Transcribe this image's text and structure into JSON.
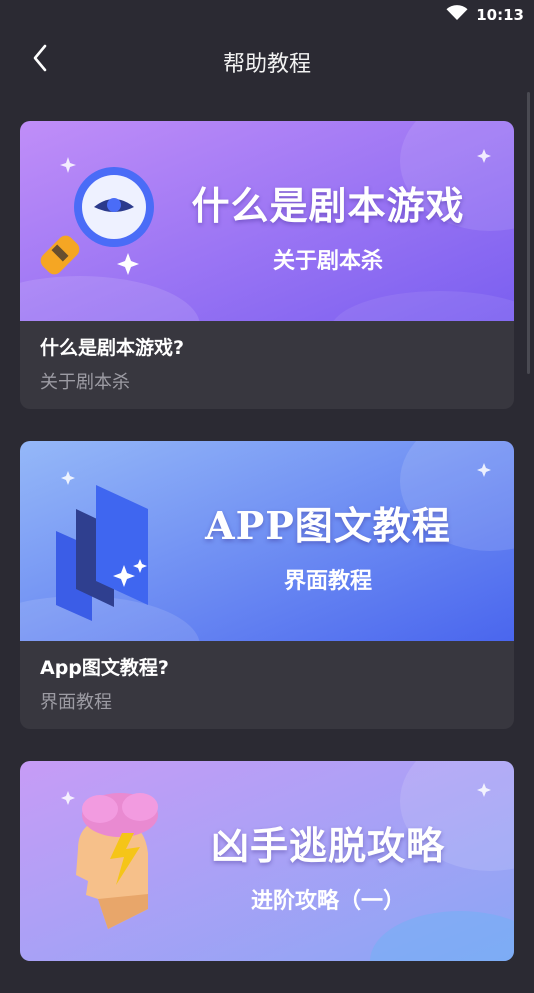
{
  "status": {
    "time": "10:13",
    "wifi_icon": "wifi-icon"
  },
  "header": {
    "title": "帮助教程",
    "back_icon": "chevron-left-icon"
  },
  "cards": [
    {
      "banner_title": "什么是剧本游戏",
      "banner_subtitle": "关于剧本杀",
      "title": "什么是剧本游戏?",
      "description": "关于剧本杀",
      "illustration": "magnifier-eye-icon",
      "gradient": [
        "#b98cf7",
        "#7b63f0"
      ]
    },
    {
      "banner_title": "APP图文教程",
      "banner_subtitle": "界面教程",
      "title": "App图文教程?",
      "description": "界面教程",
      "illustration": "stacked-pages-icon",
      "gradient": [
        "#8fb4f7",
        "#4f6ff0"
      ]
    },
    {
      "banner_title": "凶手逃脱攻略",
      "banner_subtitle": "进阶攻略（一）",
      "illustration": "head-brain-icon",
      "gradient": [
        "#c79cf6",
        "#8fa8f5"
      ]
    }
  ]
}
